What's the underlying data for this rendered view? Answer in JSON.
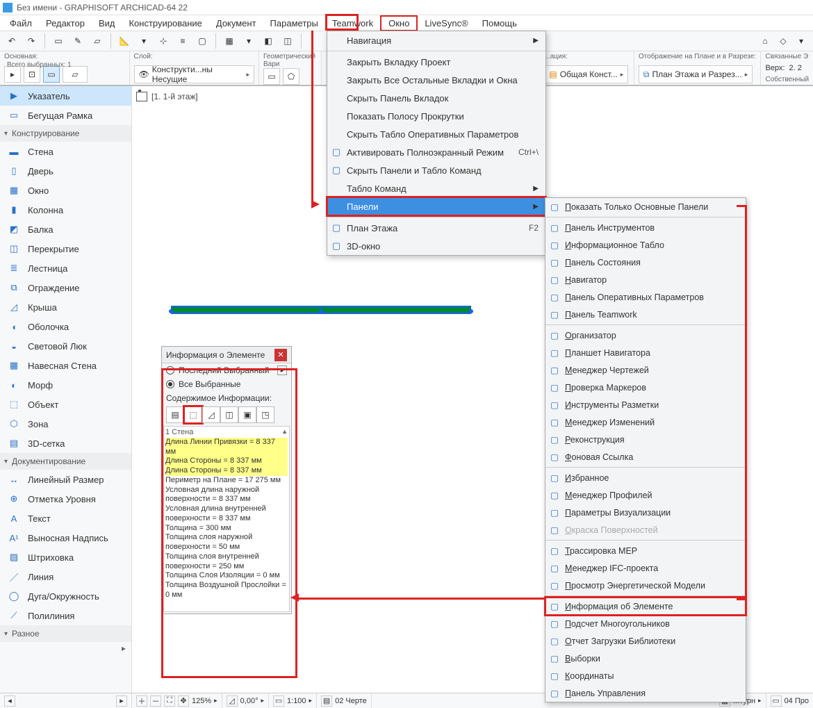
{
  "title": "Без имени - GRAPHISOFT ARCHICAD-64 22",
  "menubar": [
    "Файл",
    "Редактор",
    "Вид",
    "Конструирование",
    "Документ",
    "Параметры",
    "Teamwork",
    "Окно",
    "LiveSync®",
    "Помощь"
  ],
  "menubar_hl_index": 7,
  "infobars": {
    "main": {
      "label": "Основная:",
      "selected_label": "Всего выбранных: 1"
    },
    "layer": {
      "label": "Слой:",
      "chip": "Конструкти...ны Несущие"
    },
    "geom": {
      "label": "Геометрический Вари"
    },
    "loc": {
      "label": "...ация:",
      "chip": "Общая Конст..."
    },
    "display": {
      "label": "Отображение на Плане и в Разрезе:",
      "chip": "План Этажа и Разрез..."
    },
    "linked": {
      "l1": "Связанные Э",
      "l2": "Верх:",
      "v2": "2. 2",
      "l3": "Собственный"
    }
  },
  "tab": "[1. 1-й этаж]",
  "toolbox": {
    "arrow": "Указатель",
    "marquee": "Бегущая Рамка",
    "head_design": "Конструирование",
    "items_design": [
      "Стена",
      "Дверь",
      "Окно",
      "Колонна",
      "Балка",
      "Перекрытие",
      "Лестница",
      "Ограждение",
      "Крыша",
      "Оболочка",
      "Световой Люк",
      "Навесная Стена",
      "Морф",
      "Объект",
      "Зона",
      "3D-сетка"
    ],
    "head_doc": "Документирование",
    "items_doc": [
      "Линейный Размер",
      "Отметка Уровня",
      "Текст",
      "Выносная Надпись",
      "Штриховка",
      "Линия",
      "Дуга/Окружность",
      "Полилиния"
    ],
    "head_misc": "Разное"
  },
  "window_menu": {
    "items": [
      {
        "label": "Навигация",
        "arrow": true
      },
      {
        "sep": true
      },
      {
        "label": "Закрыть Вкладку Проект"
      },
      {
        "label": "Закрыть Все Остальные Вкладки и Окна"
      },
      {
        "label": "Скрыть Панель Вкладок"
      },
      {
        "label": "Показать Полосу Прокрутки"
      },
      {
        "label": "Скрыть Табло Оперативных Параметров"
      },
      {
        "label": "Активировать Полноэкранный Режим",
        "shortcut": "Ctrl+\\",
        "icon": "fullscreen-icon"
      },
      {
        "label": "Скрыть Панели и Табло Команд",
        "icon": "hide-panels-icon"
      },
      {
        "label": "Табло Команд",
        "arrow": true
      },
      {
        "label": "Панели",
        "arrow": true,
        "hl": true,
        "boxed": true
      },
      {
        "sep": true
      },
      {
        "label": "План Этажа",
        "shortcut": "F2",
        "icon": "floorplan-icon"
      },
      {
        "label": "3D-окно",
        "icon": "3d-window-icon"
      }
    ]
  },
  "panels_submenu": [
    {
      "label": "Показать Только Основные Панели",
      "icon": "layout-panels-icon"
    },
    {
      "sep": true
    },
    {
      "label": "Панель Инструментов",
      "icon": "toolbox-icon"
    },
    {
      "label": "Информационное Табло",
      "icon": "infobar-icon"
    },
    {
      "label": "Панель Состояния"
    },
    {
      "label": "Навигатор",
      "icon": "navigator-icon"
    },
    {
      "label": "Панель Оперативных Параметров",
      "icon": "quick-options-icon"
    },
    {
      "label": "Панель Teamwork",
      "icon": "teamwork-icon"
    },
    {
      "sep": true
    },
    {
      "label": "Организатор",
      "icon": "organizer-icon"
    },
    {
      "label": "Планшет Навигатора",
      "icon": "nav-medium-icon"
    },
    {
      "label": "Менеджер Чертежей",
      "icon": "drawing-manager-icon"
    },
    {
      "label": "Проверка Маркеров",
      "icon": "marker-check-icon"
    },
    {
      "label": "Инструменты Разметки",
      "icon": "markup-tools-icon"
    },
    {
      "label": "Менеджер Изменений",
      "icon": "change-manager-icon"
    },
    {
      "label": "Реконструкция",
      "icon": "renovation-icon"
    },
    {
      "label": "Фоновая Ссылка",
      "icon": "background-icon"
    },
    {
      "sep": true
    },
    {
      "label": "Избранное",
      "icon": "favorite-star-icon"
    },
    {
      "label": "Менеджер Профилей",
      "icon": "profile-manager-icon"
    },
    {
      "label": "Параметры Визуализации",
      "icon": "render-settings-icon"
    },
    {
      "label": "Окраска Поверхностей",
      "icon": "surface-icon",
      "disabled": true
    },
    {
      "sep": true
    },
    {
      "label": "Трассировка MEP",
      "icon": "mep-icon"
    },
    {
      "label": "Менеджер IFC-проекта",
      "icon": "ifc-icon"
    },
    {
      "label": "Просмотр Энергетической Модели",
      "icon": "energy-icon"
    },
    {
      "sep": true
    },
    {
      "label": "Информация об Элементе",
      "icon": "element-info-icon",
      "boxed": true
    },
    {
      "label": "Подсчет Многоугольников",
      "icon": "polygon-count-icon"
    },
    {
      "label": "Отчет Загрузки Библиотеки",
      "icon": "library-report-icon"
    },
    {
      "label": "Выборки",
      "icon": "selections-icon"
    },
    {
      "label": "Координаты",
      "icon": "coords-icon"
    },
    {
      "label": "Панель Управления",
      "icon": "control-panel-icon"
    }
  ],
  "info_panel": {
    "title": "Информация о Элементе",
    "radio1": "Последний Выбранный",
    "radio2": "Все Выбранные",
    "subhead": "Содержимое Информации:",
    "header_line": "1 Стена",
    "lines": [
      {
        "t": "Длина Линии Привязки = 8 337 мм",
        "y": true
      },
      {
        "t": "Длина Стороны = 8 337 мм",
        "y": true
      },
      {
        "t": "Длина Стороны = 8 337 мм",
        "y": true
      },
      {
        "t": "Периметр на Плане = 17 275 мм"
      },
      {
        "t": "Условная длина наружной поверхности = 8 337 мм"
      },
      {
        "t": "Условная длина внутренней поверхности = 8 337 мм"
      },
      {
        "t": "Толщина = 300 мм"
      },
      {
        "t": "Толщина слоя наружной поверхности = 50 мм"
      },
      {
        "t": "Толщина слоя внутренней поверхности = 250 мм"
      },
      {
        "t": "Толщина Слоя Изоляции = 0 мм"
      },
      {
        "t": "Толщина Воздушной Прослойки = 0 мм"
      }
    ]
  },
  "statusbar": {
    "zoom": "125%",
    "angle": "0,00°",
    "scale": "1:100",
    "view": "02 Черте",
    "sheet": "04 Про",
    "right_extra": "...турн"
  }
}
